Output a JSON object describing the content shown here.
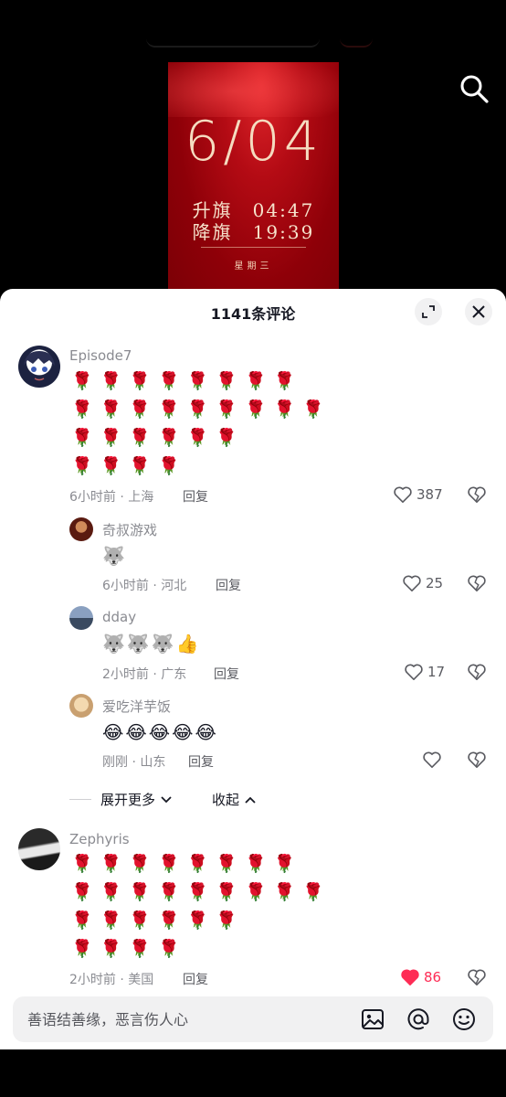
{
  "poster": {
    "date": "6/04",
    "raise": "升旗　04:47",
    "lower": "降旗　19:39",
    "weekday": "星期三"
  },
  "sheet": {
    "title": "1141条评论"
  },
  "comments": [
    {
      "user": "Episode7",
      "rows": [
        "🌹🌹🌹🌹🌹🌹🌹🌹",
        "🌹🌹🌹🌹🌹🌹🌹🌹🌹",
        "🌹🌹🌹🌹🌹🌹",
        "🌹🌹🌹🌹"
      ],
      "meta": "6小时前 · 上海",
      "reply": "回复",
      "likes": "387"
    },
    {
      "user": "奇叔游戏",
      "content": "🐺",
      "meta": "6小时前 · 河北",
      "reply": "回复",
      "likes": "25"
    },
    {
      "user": "dday",
      "content": "🐺🐺🐺👍",
      "meta": "2小时前 · 广东",
      "reply": "回复",
      "likes": "17"
    },
    {
      "user": "爱吃洋芋饭",
      "content": "😂😂😂😂😂",
      "meta": "刚刚 · 山东",
      "reply": "回复",
      "likes": ""
    },
    {
      "user": "Zephyris",
      "rows": [
        "🌹🌹🌹🌹🌹🌹🌹🌹",
        "🌹🌹🌹🌹🌹🌹🌹🌹🌹",
        "🌹🌹🌹🌹🌹🌹",
        "🌹🌹🌹🌹"
      ],
      "meta": "2小时前 · 美国",
      "reply": "回复",
      "likes": "86"
    }
  ],
  "thread": {
    "more": "展开更多",
    "collapse": "收起"
  },
  "input": {
    "placeholder": "善语结善缘，恶言伤人心"
  },
  "colors": {
    "accent": "#fe2c55",
    "poster_red": "#b40b14"
  }
}
